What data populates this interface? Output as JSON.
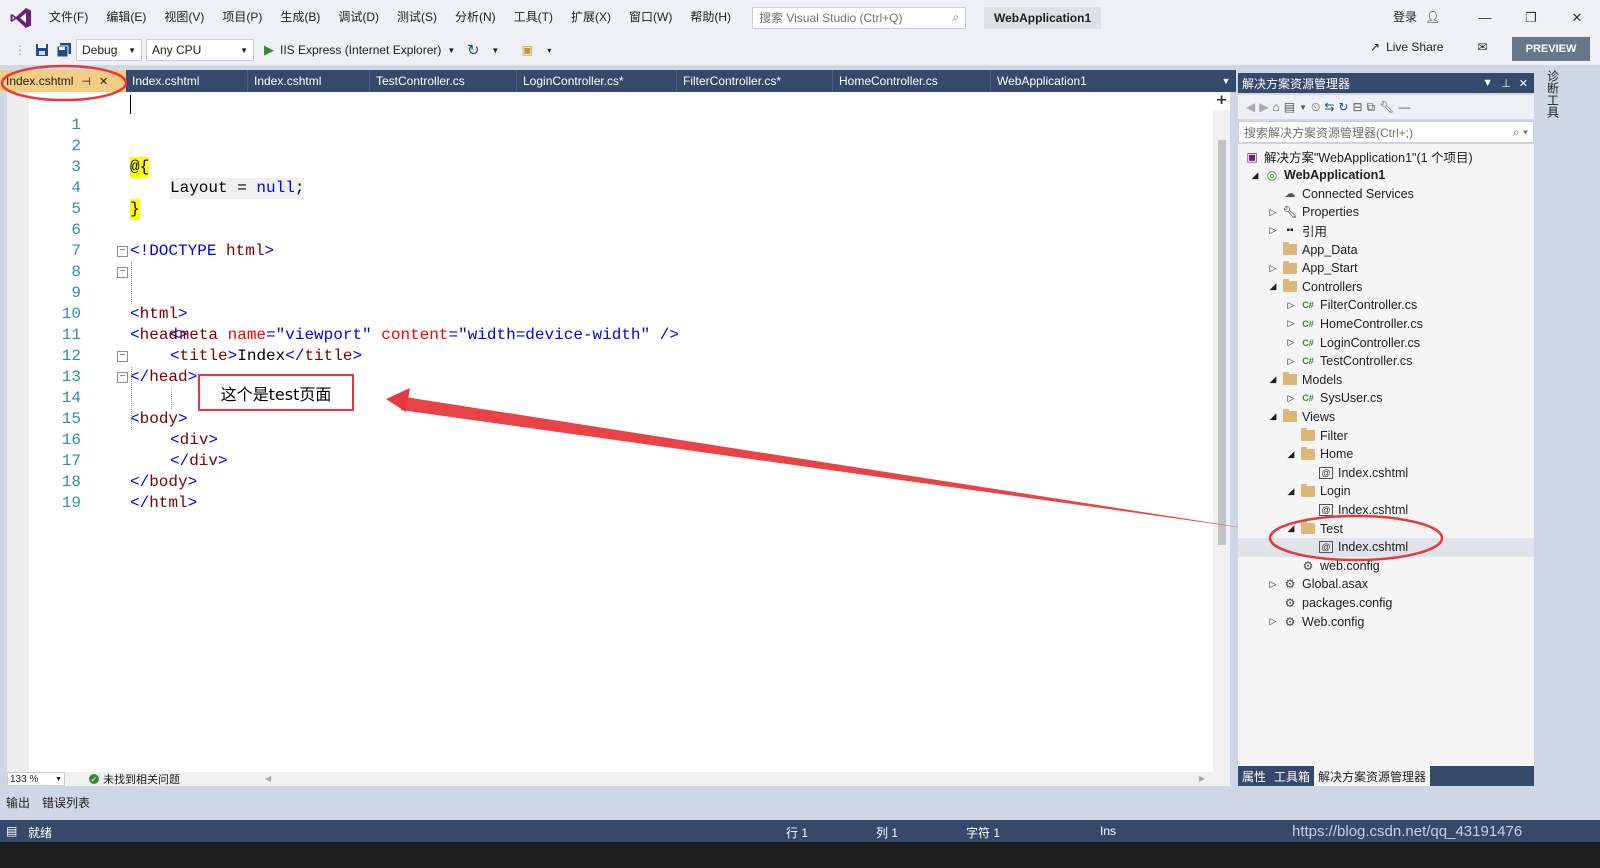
{
  "menu": [
    "文件(F)",
    "编辑(E)",
    "视图(V)",
    "项目(P)",
    "生成(B)",
    "调试(D)",
    "测试(S)",
    "分析(N)",
    "工具(T)",
    "扩展(X)",
    "窗口(W)",
    "帮助(H)"
  ],
  "search_placeholder": "搜索 Visual Studio (Ctrl+Q)",
  "solution_title": "WebApplication1",
  "login_label": "登录",
  "toolbar": {
    "config": "Debug",
    "platform": "Any CPU",
    "run_target": "IIS Express (Internet Explorer)",
    "live_share": "Live Share",
    "preview": "PREVIEW"
  },
  "tabs": [
    "Index.cshtml",
    "Index.cshtml",
    "Index.cshtml",
    "TestController.cs",
    "LoginController.cs*",
    "FilterController.cs*",
    "HomeController.cs",
    "WebApplication1"
  ],
  "code": {
    "line_numbers": [
      "1",
      "2",
      "3",
      "4",
      "5",
      "6",
      "7",
      "8",
      "9",
      "10",
      "11",
      "12",
      "13",
      "14",
      "15",
      "16",
      "17",
      "18",
      "19"
    ],
    "l2_razor": "@{",
    "l3_layout": "Layout = ",
    "l3_null": "null",
    "l3_semi": ";",
    "l4_close": "}",
    "l6_doctype_open": "<!DOCTYPE ",
    "l6_doctype_html": "html",
    "l6_doctype_close": ">",
    "html": "html",
    "head": "head",
    "meta": "meta",
    "name_attr": "name",
    "name_val": "\"viewport\"",
    "content_attr": "content",
    "content_val": "\"width=device-width\"",
    "self_close": " />",
    "title": "title",
    "title_text": "Index",
    "body": "body",
    "div": "div"
  },
  "annotation_text": "这个是test页面",
  "editor_status": {
    "zoom": "133 %",
    "issues": "未找到相关问题"
  },
  "solution_explorer": {
    "title": "解决方案资源管理器",
    "search_placeholder": "搜索解决方案资源管理器(Ctrl+;)",
    "tree": [
      {
        "label": "解决方案\"WebApplication1\"(1 个项目)",
        "icon": "solution-icon",
        "expander": ""
      },
      {
        "label": "WebApplication1",
        "icon": "web-project-icon",
        "expander": "◢"
      },
      {
        "label": "Connected Services",
        "icon": "connected-services-icon",
        "expander": ""
      },
      {
        "label": "Properties",
        "icon": "wrench-icon",
        "expander": "▷"
      },
      {
        "label": "引用",
        "icon": "references-icon",
        "expander": "▷"
      },
      {
        "label": "App_Data",
        "icon": "folder-icon",
        "expander": ""
      },
      {
        "label": "App_Start",
        "icon": "folder-icon",
        "expander": "▷"
      },
      {
        "label": "Controllers",
        "icon": "folder-icon",
        "expander": "◢"
      },
      {
        "label": "FilterController.cs",
        "icon": "csharp-file-icon",
        "expander": "▷"
      },
      {
        "label": "HomeController.cs",
        "icon": "csharp-file-icon",
        "expander": "▷"
      },
      {
        "label": "LoginController.cs",
        "icon": "csharp-file-icon",
        "expander": "▷"
      },
      {
        "label": "TestController.cs",
        "icon": "csharp-file-icon",
        "expander": "▷"
      },
      {
        "label": "Models",
        "icon": "folder-icon",
        "expander": "◢"
      },
      {
        "label": "SysUser.cs",
        "icon": "csharp-file-icon",
        "expander": "▷"
      },
      {
        "label": "Views",
        "icon": "folder-icon",
        "expander": "◢"
      },
      {
        "label": "Filter",
        "icon": "folder-icon",
        "expander": ""
      },
      {
        "label": "Home",
        "icon": "folder-icon",
        "expander": "◢"
      },
      {
        "label": "Index.cshtml",
        "icon": "razor-file-icon",
        "expander": ""
      },
      {
        "label": "Login",
        "icon": "folder-icon",
        "expander": "◢"
      },
      {
        "label": "Index.cshtml",
        "icon": "razor-file-icon",
        "expander": ""
      },
      {
        "label": "Test",
        "icon": "folder-icon",
        "expander": "◢"
      },
      {
        "label": "Index.cshtml",
        "icon": "razor-file-icon",
        "expander": ""
      },
      {
        "label": "web.config",
        "icon": "config-file-icon",
        "expander": ""
      },
      {
        "label": "Global.asax",
        "icon": "config-file-icon",
        "expander": "▷"
      },
      {
        "label": "packages.config",
        "icon": "config-file-icon",
        "expander": ""
      },
      {
        "label": "Web.config",
        "icon": "config-file-icon",
        "expander": "▷"
      }
    ],
    "bottom_tabs": [
      "属性",
      "工具箱",
      "解决方案资源管理器"
    ]
  },
  "right_rail": "诊断工具",
  "output_tabs": [
    "输出",
    "错误列表"
  ],
  "statusbar": {
    "ready": "就绪",
    "line": "行 1",
    "col": "列 1",
    "char": "字符 1",
    "mode": "Ins"
  },
  "watermark": "https://blog.csdn.net/qq_43191476",
  "colors": {
    "annotation_red": "#e8383d",
    "active_tab": "#f5cc84",
    "chrome_blue": "#354a6b"
  }
}
